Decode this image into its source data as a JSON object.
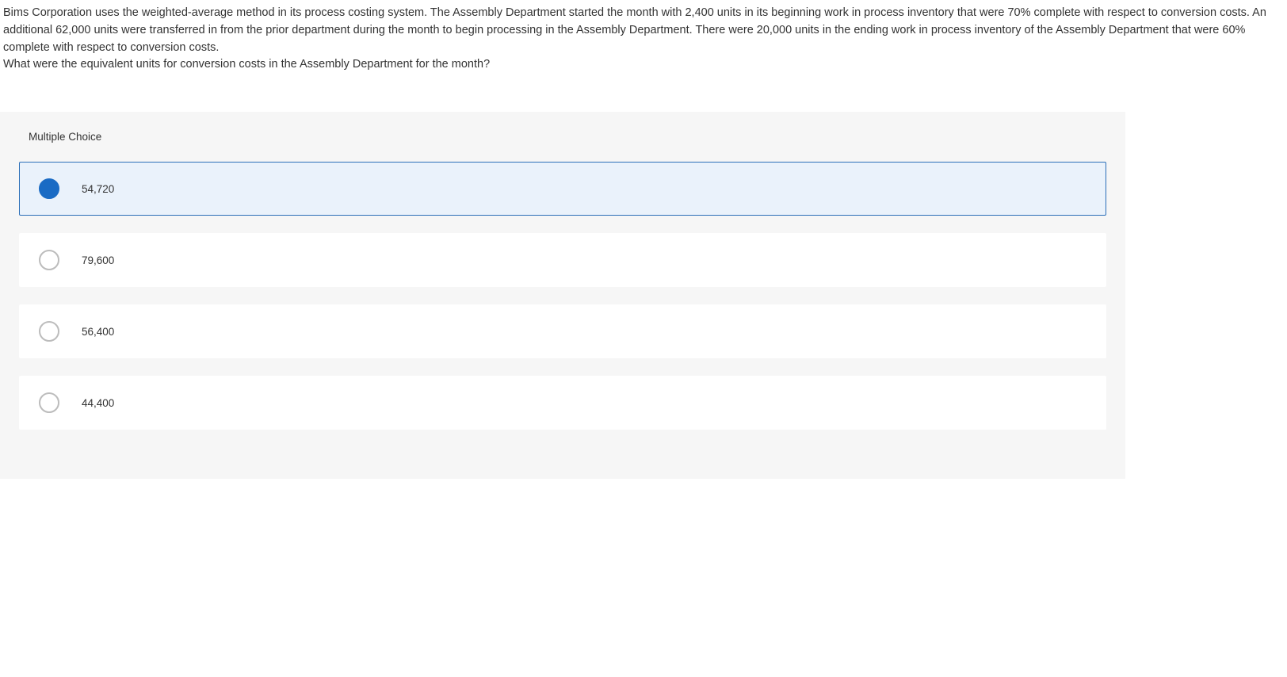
{
  "question": {
    "prompt": "Bims Corporation uses the weighted-average method in its process costing system. The Assembly Department started the month with 2,400 units in its beginning work in process inventory that were 70% complete with respect to conversion costs. An additional 62,000 units were transferred in from the prior department during the month to begin processing in the Assembly Department. There were 20,000 units in the ending work in process inventory of the Assembly Department that were 60% complete with respect to conversion costs.",
    "sub_prompt": "What were the equivalent units for conversion costs in the Assembly Department for the month?"
  },
  "section_label": "Multiple Choice",
  "options": [
    {
      "label": "54,720",
      "selected": true
    },
    {
      "label": "79,600",
      "selected": false
    },
    {
      "label": "56,400",
      "selected": false
    },
    {
      "label": "44,400",
      "selected": false
    }
  ]
}
